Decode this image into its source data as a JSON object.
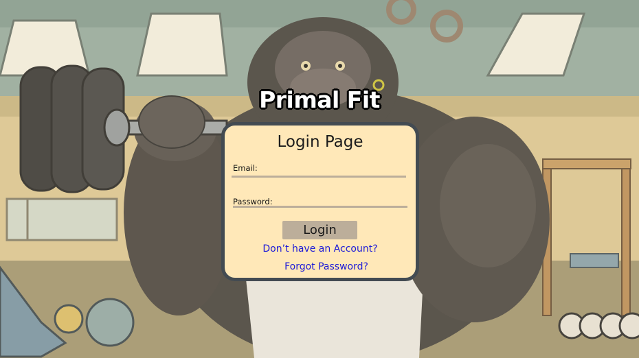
{
  "app": {
    "brand_title": "Primal Fit"
  },
  "login": {
    "title": "Login Page",
    "email_label": "Email:",
    "email_value": "",
    "password_label": "Password:",
    "password_value": "",
    "submit_label": "Login",
    "signup_link": "Don’t have an Account?",
    "forgot_link": "Forgot Password?"
  },
  "theme": {
    "card_background": "#ffe8b8",
    "card_border": "#434b52",
    "input_underline": "#bcae9a",
    "button_background": "#bcae9a",
    "link_color": "#1d1ad8"
  },
  "background": {
    "description_icon": "gorilla-lifting-dumbbell-illustration"
  }
}
